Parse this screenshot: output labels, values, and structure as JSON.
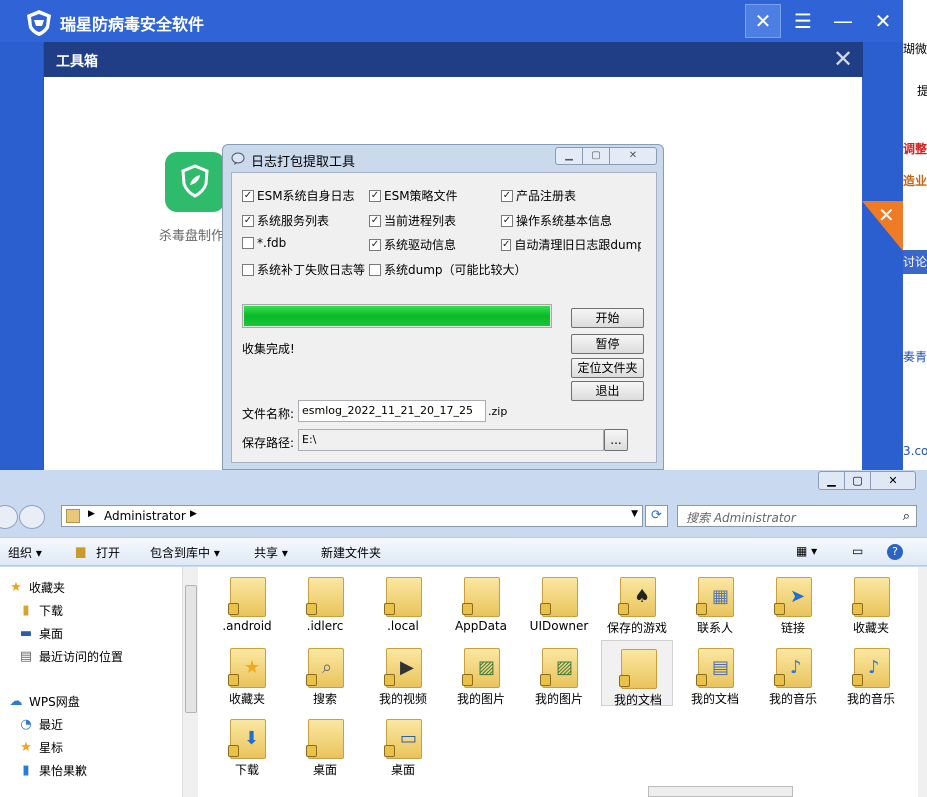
{
  "av": {
    "title": "瑞星防病毒安全软件",
    "toolbox": {
      "title": "工具箱",
      "tool_label": "杀毒盘制作"
    }
  },
  "bg_strip": [
    "瑚微信",
    "提",
    "调整经",
    "造业",
    "讨论",
    "奏青",
    "3.co"
  ],
  "log_dialog": {
    "title": "日志打包提取工具",
    "checkboxes": [
      {
        "label": "ESM系统自身日志",
        "checked": true
      },
      {
        "label": "ESM策略文件",
        "checked": true
      },
      {
        "label": "产品注册表",
        "checked": true
      },
      {
        "label": "系统服务列表",
        "checked": true
      },
      {
        "label": "当前进程列表",
        "checked": true
      },
      {
        "label": "操作系统基本信息",
        "checked": true
      },
      {
        "label": "*.fdb",
        "checked": false
      },
      {
        "label": "系统驱动信息",
        "checked": true
      },
      {
        "label": "自动清理旧日志跟dump",
        "checked": true
      },
      {
        "label": "系统补丁失败日志等",
        "checked": false
      },
      {
        "label": "系统dump（可能比较大）",
        "checked": false
      }
    ],
    "progress": 1.0,
    "status": "收集完成!",
    "buttons": {
      "start": "开始",
      "pause": "暂停",
      "locate": "定位文件夹",
      "exit": "退出",
      "browse": "..."
    },
    "filename_label": "文件名称:",
    "filename_value": "esmlog_2022_11_21_20_17_25",
    "filename_ext": ".zip",
    "savepath_label": "保存路径:",
    "savepath_value": "E:\\"
  },
  "explorer": {
    "address": "Administrator",
    "search_placeholder": "搜索 Administrator",
    "commands": {
      "organize": "组织 ▾",
      "open": "打开",
      "include": "包含到库中 ▾",
      "share": "共享 ▾",
      "new_folder": "新建文件夹"
    },
    "nav": [
      "收藏夹",
      "下载",
      "桌面",
      "最近访问的位置",
      "WPS网盘",
      "最近",
      "星标",
      "果怡果歉"
    ],
    "files": [
      ".android",
      ".idlerc",
      ".local",
      "AppData",
      "UIDowner",
      "保存的游戏",
      "联系人",
      "链接",
      "收藏夹",
      "收藏夹",
      "搜索",
      "我的视频",
      "我的图片",
      "我的图片",
      "我的文档",
      "我的文档",
      "我的音乐",
      "我的音乐",
      "下载",
      "桌面",
      "桌面"
    ]
  }
}
